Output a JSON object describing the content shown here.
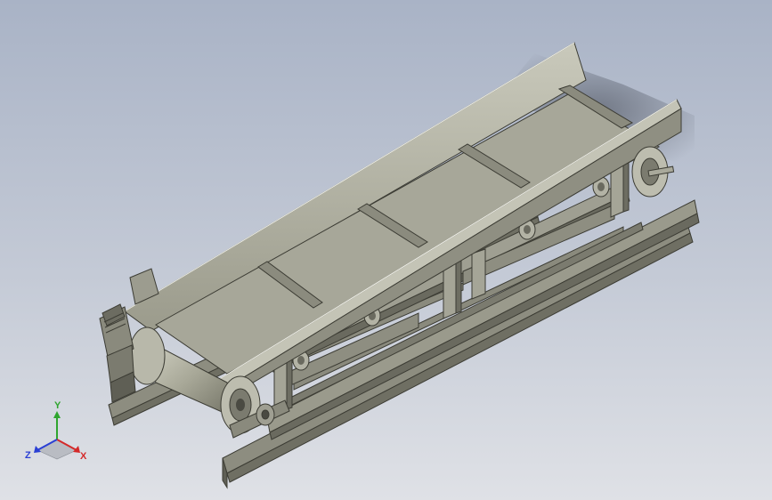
{
  "viewport": {
    "background_top": "#a9b3c6",
    "background_bottom": "#dfe1e6",
    "model": "belt-conveyor-assembly"
  },
  "triad": {
    "x_label": "X",
    "y_label": "Y",
    "z_label": "Z",
    "x_color": "#d42a2a",
    "y_color": "#2fa52f",
    "z_color": "#2a3fd4"
  }
}
